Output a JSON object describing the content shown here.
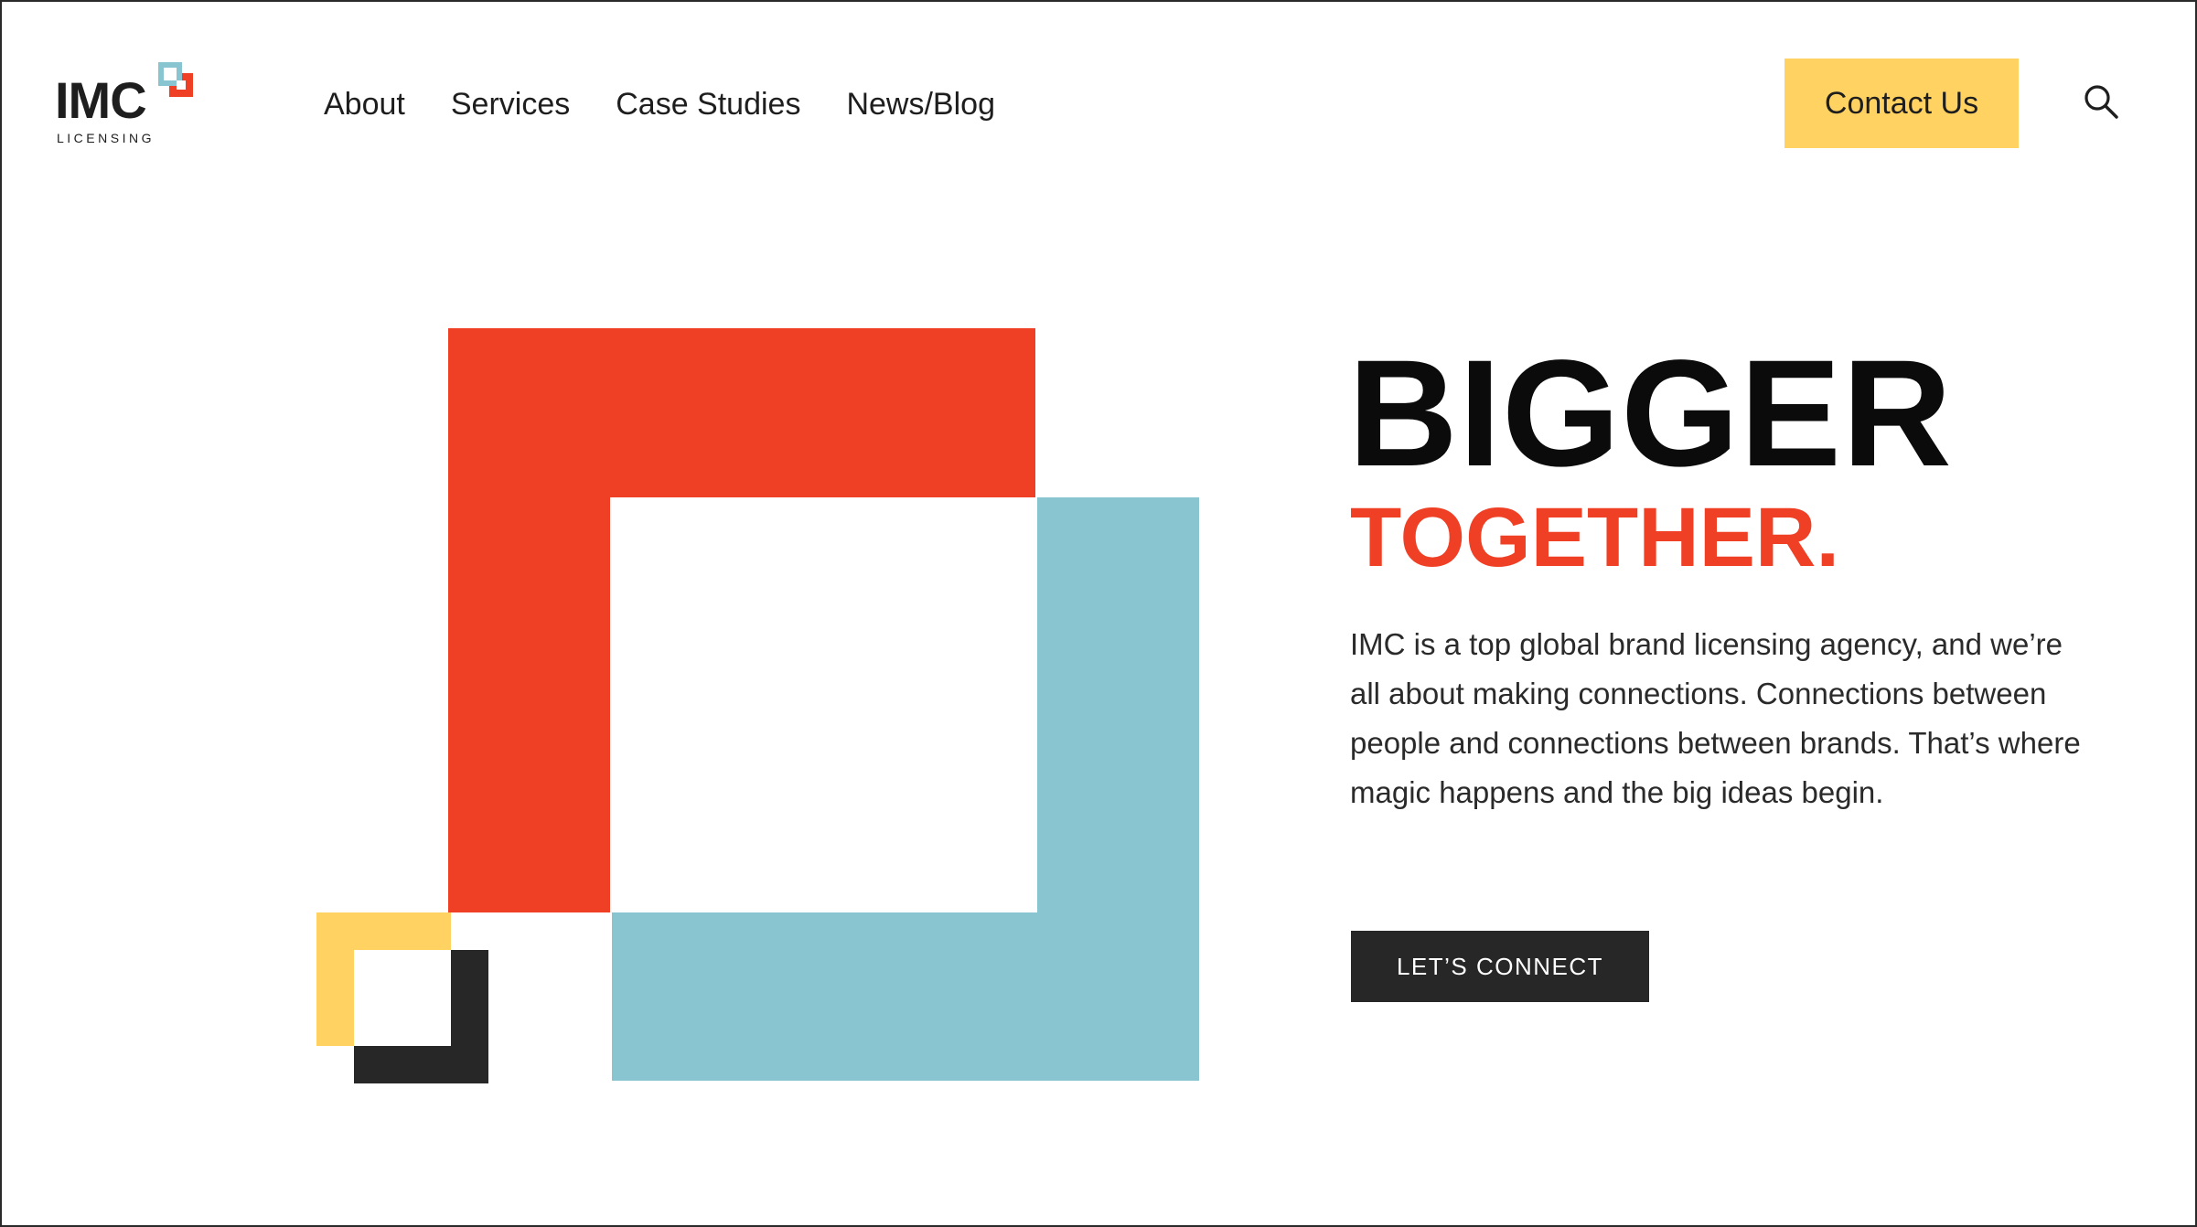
{
  "header": {
    "logo": {
      "text": "IMC",
      "subtext": "LICENSING"
    },
    "nav": [
      {
        "label": "About"
      },
      {
        "label": "Services"
      },
      {
        "label": "Case Studies"
      },
      {
        "label": "News/Blog"
      }
    ],
    "contact_label": "Contact Us",
    "search_icon": "search-icon"
  },
  "hero": {
    "title": "BIGGER",
    "subtitle": "TOGETHER.",
    "body": "IMC is a top global brand licensing agency, and we’re all about making connections. Connections between people and connections between brands. That’s where magic happens and the big ideas begin.",
    "cta_label": "LET’S CONNECT"
  },
  "colors": {
    "red": "#ef4026",
    "blue": "#89c5d0",
    "yellow": "#ffd262",
    "dark": "#272727",
    "black": "#0b0b0b"
  }
}
